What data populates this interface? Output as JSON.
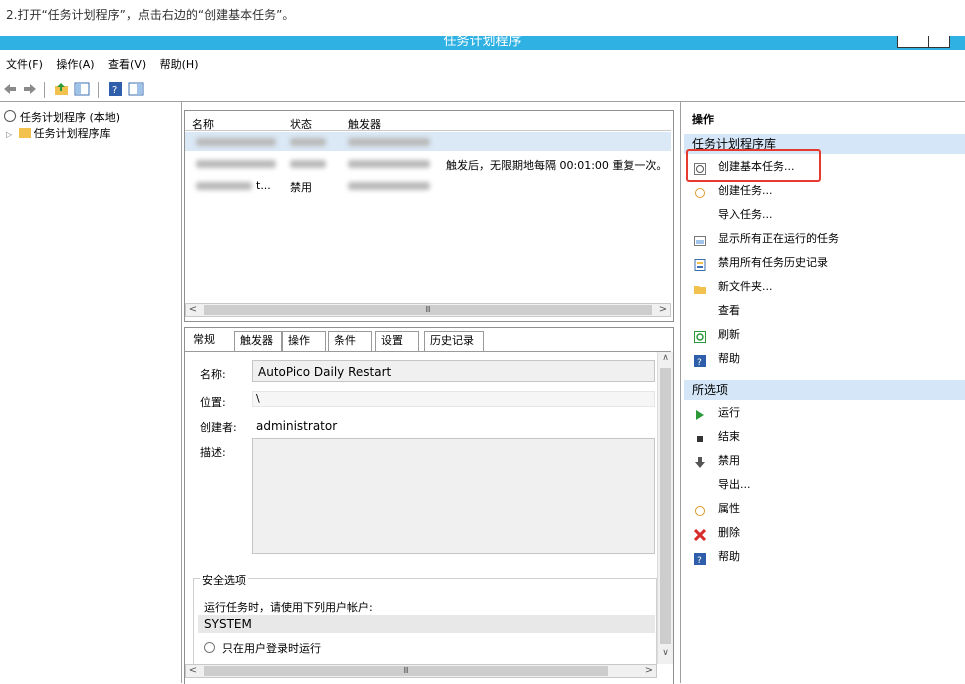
{
  "caption": "2.打开“任务计划程序”，点击右边的“创建基本任务”。",
  "window": {
    "title": "任务计划程序"
  },
  "menu": [
    "文件(F)",
    "操作(A)",
    "查看(V)",
    "帮助(H)"
  ],
  "tree": {
    "root": "任务计划程序 (本地)",
    "library": "任务计划程序库"
  },
  "task_list": {
    "columns": [
      "名称",
      "状态",
      "触发器"
    ],
    "rows": [
      {
        "name": "",
        "status": "",
        "trigger": ""
      },
      {
        "name": "",
        "status": "",
        "trigger": "触发后，无限期地每隔 00:01:00 重复一次。"
      },
      {
        "name": "t...",
        "status": "禁用",
        "trigger": ""
      }
    ]
  },
  "scroll_glyph": "Ⅲ",
  "tabs": [
    "常规",
    "触发器",
    "操作",
    "条件",
    "设置",
    "历史记录"
  ],
  "details": {
    "name_label": "名称:",
    "name_value": "AutoPico Daily Restart",
    "location_label": "位置:",
    "location_value": "\\",
    "author_label": "创建者:",
    "author_value": "administrator",
    "desc_label": "描述:",
    "security_group": "安全选项",
    "run_as_label": "运行任务时，请使用下列用户帐户:",
    "run_as_value": "SYSTEM",
    "radio_logged_on": "只在用户登录时运行"
  },
  "actions": {
    "header": "操作",
    "section1": "任务计划程序库",
    "items1": [
      "创建基本任务...",
      "创建任务...",
      "导入任务...",
      "显示所有正在运行的任务",
      "禁用所有任务历史记录",
      "新文件夹...",
      "查看",
      "刷新",
      "帮助"
    ],
    "section2": "所选项",
    "items2": [
      "运行",
      "结束",
      "禁用",
      "导出...",
      "属性",
      "删除",
      "帮助"
    ]
  },
  "colors": {
    "titlebar": "#2fb1e3",
    "highlight": "#e53b2f",
    "section_bg": "#d4e6f7"
  }
}
